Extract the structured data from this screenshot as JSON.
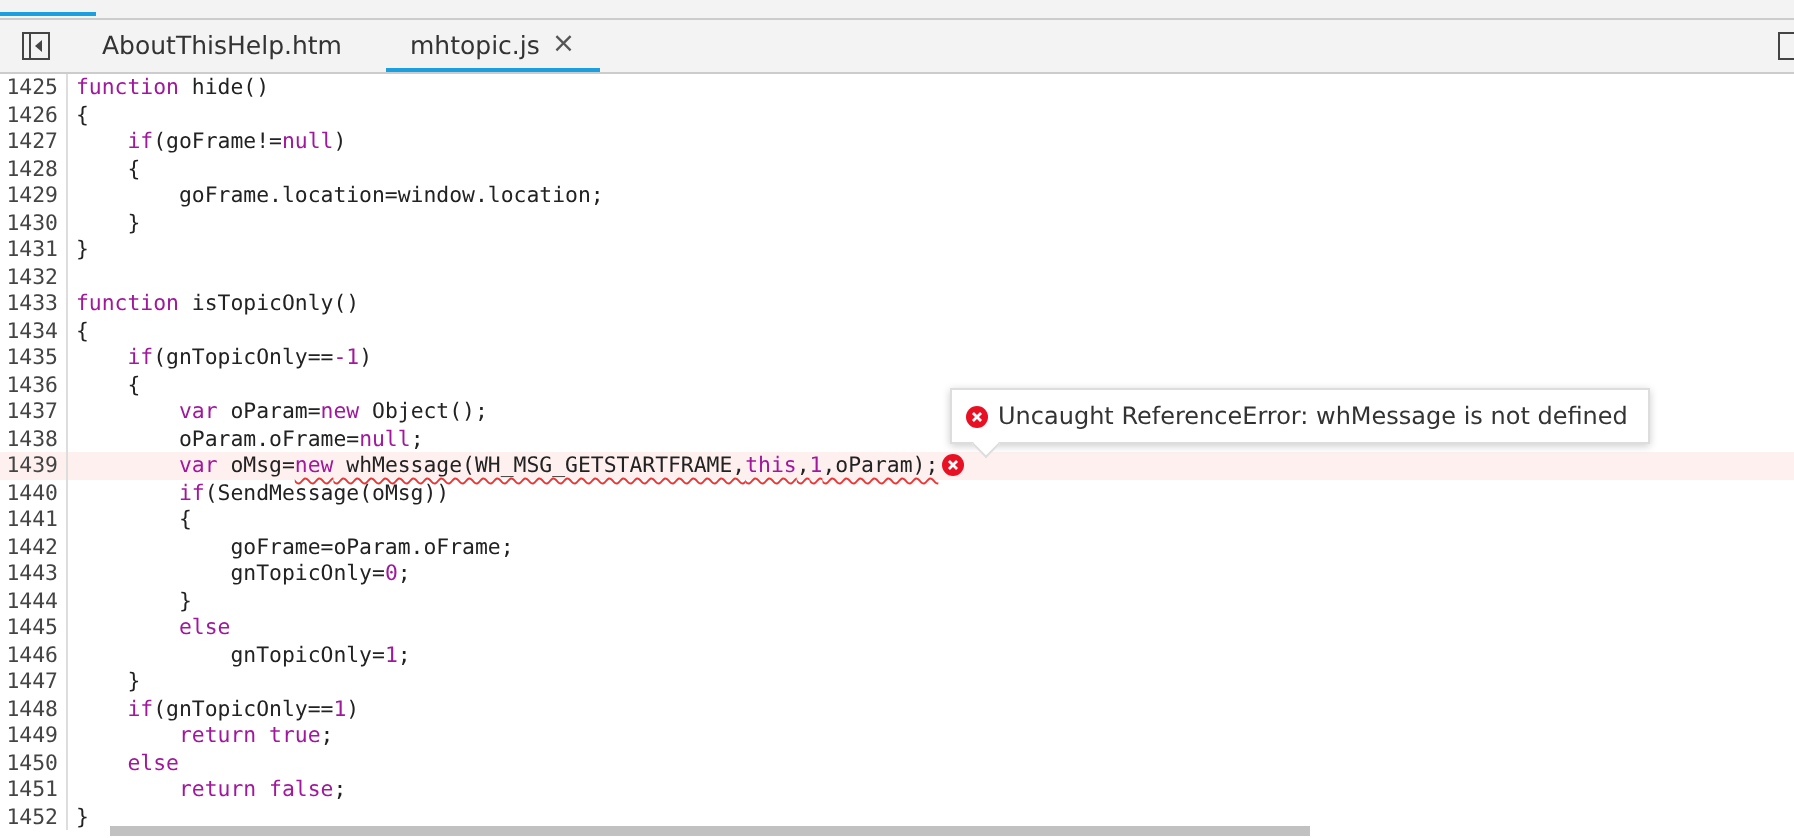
{
  "tabs": [
    {
      "label": "AboutThisHelp.htm",
      "selected": false
    },
    {
      "label": "mhtopic.js",
      "selected": true,
      "close": "×"
    }
  ],
  "lines": [
    {
      "number": "1425",
      "error": false,
      "tokens": [
        {
          "text": "function",
          "kind": "keyword"
        },
        {
          "text": " hide()",
          "kind": "plain"
        }
      ]
    },
    {
      "number": "1426",
      "error": false,
      "tokens": [
        {
          "text": "{",
          "kind": "plain"
        }
      ]
    },
    {
      "number": "1427",
      "error": false,
      "tokens": [
        {
          "text": "    if",
          "kind": "keyword"
        },
        {
          "text": "(goFrame!=",
          "kind": "plain"
        },
        {
          "text": "null",
          "kind": "keyword"
        },
        {
          "text": ")",
          "kind": "plain"
        }
      ]
    },
    {
      "number": "1428",
      "error": false,
      "tokens": [
        {
          "text": "    {",
          "kind": "plain"
        }
      ]
    },
    {
      "number": "1429",
      "error": false,
      "tokens": [
        {
          "text": "        goFrame.location=window.location;",
          "kind": "plain"
        }
      ]
    },
    {
      "number": "1430",
      "error": false,
      "tokens": [
        {
          "text": "    }",
          "kind": "plain"
        }
      ]
    },
    {
      "number": "1431",
      "error": false,
      "tokens": [
        {
          "text": "}",
          "kind": "plain"
        }
      ]
    },
    {
      "number": "1432",
      "error": false
    },
    {
      "number": "1433",
      "error": false,
      "tokens": [
        {
          "text": "function",
          "kind": "keyword"
        },
        {
          "text": " isTopicOnly()",
          "kind": "plain"
        }
      ]
    },
    {
      "number": "1434",
      "error": false,
      "tokens": [
        {
          "text": "{",
          "kind": "plain"
        }
      ]
    },
    {
      "number": "1435",
      "error": false,
      "tokens": [
        {
          "text": "    if",
          "kind": "keyword"
        },
        {
          "text": "(gnTopicOnly==",
          "kind": "plain"
        },
        {
          "text": "-1",
          "kind": "keyword"
        },
        {
          "text": ")",
          "kind": "plain"
        }
      ]
    },
    {
      "number": "1436",
      "error": false,
      "tokens": [
        {
          "text": "    {",
          "kind": "plain"
        }
      ]
    },
    {
      "number": "1437",
      "error": false,
      "tokens": [
        {
          "text": "        var",
          "kind": "keyword"
        },
        {
          "text": " oParam=",
          "kind": "plain"
        },
        {
          "text": "new",
          "kind": "keyword"
        },
        {
          "text": " Object();",
          "kind": "plain"
        }
      ]
    },
    {
      "number": "1438",
      "error": false,
      "tokens": [
        {
          "text": "        oParam.oFrame=",
          "kind": "plain"
        },
        {
          "text": "null",
          "kind": "keyword"
        },
        {
          "text": ";",
          "kind": "plain"
        }
      ]
    },
    {
      "number": "1439",
      "error": true,
      "tokens": [
        {
          "text": "        var",
          "kind": "keyword",
          "squiggle": false
        },
        {
          "text": " oMsg=",
          "kind": "plain",
          "squiggle": false
        },
        {
          "text": "new",
          "kind": "keyword",
          "squiggle": true
        },
        {
          "text": " whMessage(WH_MSG_GETSTARTFRAME,",
          "kind": "plain",
          "squiggle": true
        },
        {
          "text": "this",
          "kind": "keyword",
          "squiggle": true
        },
        {
          "text": ",",
          "kind": "plain",
          "squiggle": true
        },
        {
          "text": "1",
          "kind": "keyword",
          "squiggle": true
        },
        {
          "text": ",oParam);",
          "kind": "plain",
          "squiggle": true
        }
      ]
    },
    {
      "number": "1440",
      "error": false,
      "tokens": [
        {
          "text": "        if",
          "kind": "keyword"
        },
        {
          "text": "(SendMessage(oMsg))",
          "kind": "plain"
        }
      ]
    },
    {
      "number": "1441",
      "error": false,
      "tokens": [
        {
          "text": "        {",
          "kind": "plain"
        }
      ]
    },
    {
      "number": "1442",
      "error": false,
      "tokens": [
        {
          "text": "            goFrame=oParam.oFrame;",
          "kind": "plain"
        }
      ]
    },
    {
      "number": "1443",
      "error": false,
      "tokens": [
        {
          "text": "            gnTopicOnly=",
          "kind": "plain"
        },
        {
          "text": "0",
          "kind": "keyword"
        },
        {
          "text": ";",
          "kind": "plain"
        }
      ]
    },
    {
      "number": "1444",
      "error": false,
      "tokens": [
        {
          "text": "        }",
          "kind": "plain"
        }
      ]
    },
    {
      "number": "1445",
      "error": false,
      "tokens": [
        {
          "text": "        else",
          "kind": "keyword"
        }
      ]
    },
    {
      "number": "1446",
      "error": false,
      "tokens": [
        {
          "text": "            gnTopicOnly=",
          "kind": "plain"
        },
        {
          "text": "1",
          "kind": "keyword"
        },
        {
          "text": ";",
          "kind": "plain"
        }
      ]
    },
    {
      "number": "1447",
      "error": false,
      "tokens": [
        {
          "text": "    }",
          "kind": "plain"
        }
      ]
    },
    {
      "number": "1448",
      "error": false,
      "tokens": [
        {
          "text": "    if",
          "kind": "keyword"
        },
        {
          "text": "(gnTopicOnly==",
          "kind": "plain"
        },
        {
          "text": "1",
          "kind": "keyword"
        },
        {
          "text": ")",
          "kind": "plain"
        }
      ]
    },
    {
      "number": "1449",
      "error": false,
      "tokens": [
        {
          "text": "        return true",
          "kind": "keyword"
        },
        {
          "text": ";",
          "kind": "plain"
        }
      ]
    },
    {
      "number": "1450",
      "error": false,
      "tokens": [
        {
          "text": "    else",
          "kind": "keyword"
        }
      ]
    },
    {
      "number": "1451",
      "error": false,
      "tokens": [
        {
          "text": "        return false",
          "kind": "keyword"
        },
        {
          "text": ";",
          "kind": "plain"
        }
      ]
    },
    {
      "number": "1452",
      "error": false,
      "tokens": [
        {
          "text": "}",
          "kind": "plain"
        }
      ]
    }
  ],
  "error_tooltip": {
    "message": "Uncaught ReferenceError: whMessage is not defined"
  }
}
